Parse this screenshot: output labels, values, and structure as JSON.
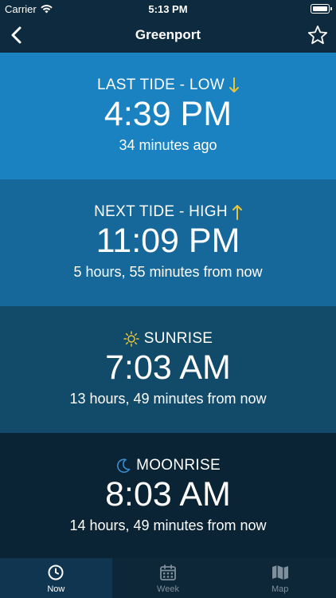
{
  "status_bar": {
    "carrier": "Carrier",
    "time": "5:13 PM"
  },
  "nav": {
    "title": "Greenport"
  },
  "cards": [
    {
      "label": "LAST TIDE - LOW",
      "value": "4:39 PM",
      "sub": "34 minutes ago",
      "icon": "arrow-down-icon",
      "bg": "#1a82c0"
    },
    {
      "label": "NEXT TIDE - HIGH",
      "value": "11:09 PM",
      "sub": "5 hours, 55 minutes from now",
      "icon": "arrow-up-icon",
      "bg": "#16689b"
    },
    {
      "label": "SUNRISE",
      "value": "7:03 AM",
      "sub": "13 hours, 49 minutes from now",
      "icon": "sun-icon",
      "bg": "#124a6a"
    },
    {
      "label": "MOONRISE",
      "value": "8:03 AM",
      "sub": "14 hours, 49 minutes from now",
      "icon": "moon-icon",
      "bg": "#0a2435"
    }
  ],
  "tabs": [
    {
      "label": "Now",
      "icon": "clock-icon",
      "active": true
    },
    {
      "label": "Week",
      "icon": "calendar-icon",
      "active": false
    },
    {
      "label": "Map",
      "icon": "map-icon",
      "active": false
    }
  ],
  "colors": {
    "accent_yellow": "#e8c53a",
    "accent_blue": "#3b8fd0",
    "header_bg": "#0e2a3e"
  }
}
